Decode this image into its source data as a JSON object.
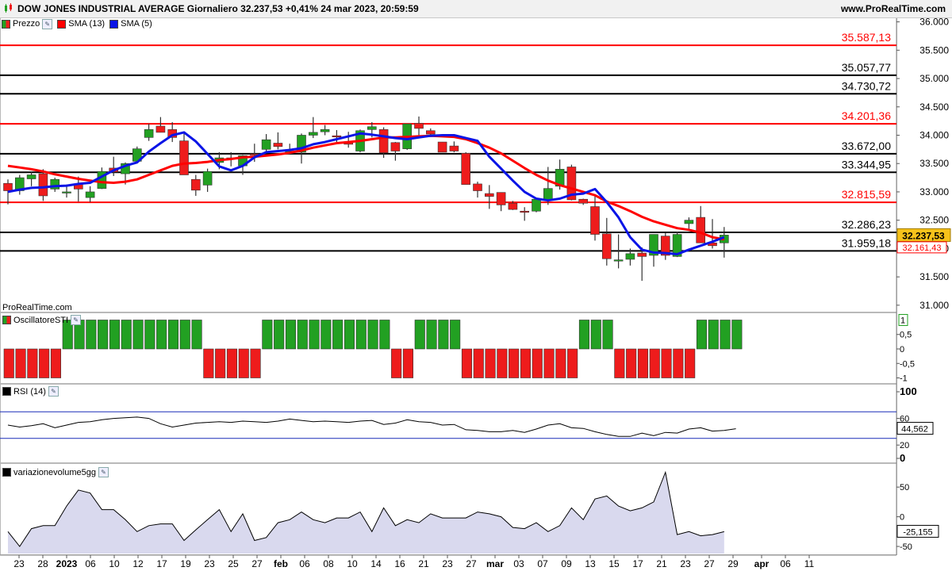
{
  "header": {
    "title": "DOW JONES INDUSTRIAL AVERAGE Giornaliero 32.237,53 +0,41% 24 mar 2023, 20:59:59",
    "site": "www.ProRealTime.com"
  },
  "legend": {
    "price": "Prezzo",
    "sma13": "SMA (13)",
    "sma5": "SMA (5)"
  },
  "watermark": "ProRealTime.com",
  "panels": {
    "sti": "OscillatoreSTI",
    "rsi": "RSI (14)",
    "vol": "variazionevolume5gg"
  },
  "colors": {
    "up": "#22a022",
    "down": "#ee1c1c",
    "sma13": "#ff0000",
    "sma5": "#0a14e6",
    "current_price_bg": "#f7c21a",
    "hline_red": "#ff0000",
    "hline_black": "#000000",
    "volume_fill": "#d9d9ee"
  },
  "chart_data": {
    "type": "candlestick",
    "title": "DOW JONES INDUSTRIAL AVERAGE Giornaliero",
    "x_labels": [
      "23",
      "28",
      "2023",
      "06",
      "10",
      "12",
      "17",
      "19",
      "23",
      "25",
      "27",
      "feb",
      "06",
      "08",
      "10",
      "14",
      "16",
      "21",
      "23",
      "27",
      "mar",
      "03",
      "07",
      "09",
      "13",
      "15",
      "17",
      "21",
      "23",
      "27",
      "29",
      "apr",
      "06",
      "11"
    ],
    "y_ticks": [
      "36.000",
      "35.500",
      "35.000",
      "34.500",
      "34.000",
      "33.500",
      "33.000",
      "32.500",
      "32.000",
      "31.500",
      "31.000"
    ],
    "y_range": [
      30900,
      36050
    ],
    "horizontal_levels": [
      {
        "value": 35587.13,
        "label": "35.587,13",
        "color": "red"
      },
      {
        "value": 35057.77,
        "label": "35.057,77",
        "color": "black"
      },
      {
        "value": 34730.72,
        "label": "34.730,72",
        "color": "black"
      },
      {
        "value": 34201.36,
        "label": "34.201,36",
        "color": "red"
      },
      {
        "value": 33672.0,
        "label": "33.672,00",
        "color": "black"
      },
      {
        "value": 33344.95,
        "label": "33.344,95",
        "color": "black"
      },
      {
        "value": 32815.59,
        "label": "32.815,59",
        "color": "red"
      },
      {
        "value": 32286.23,
        "label": "32.286,23",
        "color": "black"
      },
      {
        "value": 31959.18,
        "label": "31.959,18",
        "color": "black"
      }
    ],
    "last_price": "32.237,53",
    "sma13_last": "32.161,43",
    "candles": [
      [
        33150,
        33220,
        32780,
        33020
      ],
      [
        33020,
        33300,
        32950,
        33250
      ],
      [
        33230,
        33360,
        33100,
        33300
      ],
      [
        33320,
        33400,
        32840,
        32930
      ],
      [
        33050,
        33250,
        33000,
        33220
      ],
      [
        33000,
        33130,
        32900,
        33000
      ],
      [
        33130,
        33270,
        32830,
        33050
      ],
      [
        32900,
        33100,
        32820,
        33000
      ],
      [
        33060,
        33430,
        33050,
        33360
      ],
      [
        33420,
        33620,
        33280,
        33350
      ],
      [
        33320,
        33520,
        33130,
        33500
      ],
      [
        33540,
        33800,
        33510,
        33760
      ],
      [
        33960,
        34200,
        33900,
        34100
      ],
      [
        34160,
        34320,
        34050,
        34050
      ],
      [
        34100,
        34230,
        33880,
        33960
      ],
      [
        33900,
        34050,
        33300,
        33300
      ],
      [
        33220,
        33300,
        32930,
        33030
      ],
      [
        33120,
        33410,
        33000,
        33360
      ],
      [
        33520,
        33700,
        33400,
        33600
      ],
      [
        33600,
        33700,
        33450,
        33580
      ],
      [
        33460,
        33650,
        33300,
        33640
      ],
      [
        33670,
        33850,
        33530,
        33650
      ],
      [
        33750,
        34020,
        33700,
        33920
      ],
      [
        33860,
        34050,
        33750,
        33800
      ],
      [
        33700,
        33850,
        33700,
        33720
      ],
      [
        33700,
        34030,
        33500,
        34000
      ],
      [
        34000,
        34320,
        33950,
        34050
      ],
      [
        34060,
        34180,
        34000,
        34100
      ],
      [
        33990,
        34090,
        33880,
        33980
      ],
      [
        33870,
        34060,
        33780,
        33840
      ],
      [
        33720,
        34100,
        33700,
        34080
      ],
      [
        34100,
        34230,
        33960,
        34150
      ],
      [
        34100,
        34140,
        33600,
        33690
      ],
      [
        33870,
        33880,
        33550,
        33720
      ],
      [
        33760,
        34200,
        33740,
        34200
      ],
      [
        34210,
        34330,
        33950,
        34120
      ],
      [
        34080,
        34120,
        34000,
        34020
      ],
      [
        33880,
        33880,
        33700,
        33700
      ],
      [
        33810,
        33890,
        33700,
        33720
      ],
      [
        33680,
        33700,
        33130,
        33130
      ],
      [
        33140,
        33180,
        32900,
        33020
      ],
      [
        32970,
        33120,
        32700,
        32920
      ],
      [
        32990,
        32990,
        32660,
        32770
      ],
      [
        32800,
        32840,
        32680,
        32690
      ],
      [
        32660,
        32730,
        32490,
        32650
      ],
      [
        32660,
        32860,
        32640,
        32870
      ],
      [
        32860,
        33440,
        32770,
        33060
      ],
      [
        33100,
        33570,
        33040,
        33400
      ],
      [
        33440,
        33480,
        32850,
        32860
      ],
      [
        32870,
        32880,
        32770,
        32800
      ],
      [
        32740,
        32950,
        32140,
        32250
      ],
      [
        32260,
        32540,
        31700,
        31820
      ],
      [
        31800,
        32250,
        31650,
        31800
      ],
      [
        31810,
        32000,
        31700,
        31910
      ],
      [
        31920,
        32020,
        31430,
        31860
      ],
      [
        31880,
        32130,
        31680,
        32250
      ],
      [
        32220,
        32280,
        31800,
        31880
      ],
      [
        31860,
        32300,
        31850,
        32250
      ],
      [
        32440,
        32550,
        32350,
        32500
      ],
      [
        32550,
        32750,
        32100,
        32100
      ],
      [
        32100,
        32520,
        32000,
        32050
      ],
      [
        32100,
        32380,
        31840,
        32237.53
      ]
    ],
    "sma5": [
      33000,
      33040,
      33070,
      33080,
      33100,
      33110,
      33140,
      33160,
      33270,
      33380,
      33460,
      33520,
      33710,
      33860,
      34000,
      34050,
      33890,
      33670,
      33450,
      33380,
      33460,
      33610,
      33700,
      33720,
      33740,
      33770,
      33840,
      33880,
      33930,
      33980,
      34030,
      34010,
      33980,
      33950,
      33930,
      33960,
      33990,
      34000,
      34000,
      33950,
      33900,
      33620,
      33410,
      33200,
      33000,
      32880,
      32850,
      32880,
      32950,
      32970,
      33050,
      32820,
      32550,
      32200,
      31980,
      31930,
      31920,
      31900,
      31980,
      32050,
      32120,
      32200
    ],
    "sma13": [
      33460,
      33430,
      33400,
      33360,
      33310,
      33270,
      33230,
      33200,
      33170,
      33160,
      33180,
      33220,
      33300,
      33380,
      33460,
      33500,
      33510,
      33530,
      33560,
      33580,
      33610,
      33620,
      33640,
      33660,
      33690,
      33730,
      33780,
      33820,
      33860,
      33880,
      33900,
      33930,
      33960,
      33960,
      33970,
      33980,
      33990,
      33980,
      33970,
      33930,
      33860,
      33780,
      33680,
      33550,
      33420,
      33300,
      33200,
      33120,
      33060,
      33000,
      32940,
      32830,
      32750,
      32660,
      32560,
      32480,
      32420,
      32360,
      32330,
      32280,
      32200,
      32161.43
    ],
    "sti": {
      "ticks": [
        "1",
        "0,5",
        "0",
        "-0,5",
        "-1"
      ],
      "y_range": [
        -1.15,
        1.15
      ],
      "bars": [
        -1,
        -1,
        -1,
        -1,
        -1,
        1,
        1,
        1,
        1,
        1,
        1,
        1,
        1,
        1,
        1,
        1,
        1,
        -1,
        -1,
        -1,
        -1,
        -1,
        1,
        1,
        1,
        1,
        1,
        1,
        1,
        1,
        1,
        1,
        1,
        -1,
        -1,
        1,
        1,
        1,
        1,
        -1,
        -1,
        -1,
        -1,
        -1,
        -1,
        -1,
        -1,
        -1,
        -1,
        1,
        1,
        1,
        -1,
        -1,
        -1,
        -1,
        -1,
        -1,
        -1,
        1,
        1,
        1,
        1
      ],
      "last": "1"
    },
    "rsi": {
      "ticks": [
        "100",
        "60",
        "20",
        "0"
      ],
      "levels": [
        70,
        30
      ],
      "y_range": [
        0,
        100
      ],
      "values": [
        50,
        47,
        49,
        52,
        46,
        50,
        54,
        55,
        58,
        60,
        61,
        62,
        60,
        52,
        47,
        50,
        53,
        54,
        55,
        54,
        56,
        55,
        54,
        56,
        59,
        57,
        55,
        56,
        55,
        54,
        56,
        57,
        51,
        53,
        58,
        55,
        54,
        50,
        51,
        43,
        42,
        40,
        40,
        42,
        39,
        44,
        50,
        52,
        46,
        45,
        40,
        36,
        33,
        33,
        38,
        34,
        39,
        38,
        44,
        46,
        41,
        42,
        44.562
      ],
      "last": "44,562"
    },
    "volume": {
      "ticks": [
        "50",
        "0",
        "-50"
      ],
      "y_range": [
        -62,
        85
      ],
      "values": [
        -25,
        -50,
        -20,
        -15,
        -15,
        18,
        45,
        40,
        12,
        12,
        -5,
        -25,
        -15,
        -12,
        -12,
        -40,
        -22,
        -5,
        12,
        -25,
        5,
        -40,
        -35,
        -10,
        -5,
        8,
        -5,
        -10,
        -2,
        -2,
        8,
        -25,
        15,
        -15,
        -5,
        -10,
        5,
        -2,
        -2,
        -2,
        8,
        5,
        0,
        -18,
        -20,
        -10,
        -25,
        -15,
        15,
        -5,
        30,
        35,
        18,
        10,
        15,
        25,
        75,
        -30,
        -25,
        -32,
        -30,
        -25.155
      ],
      "last": "-25,155"
    }
  }
}
